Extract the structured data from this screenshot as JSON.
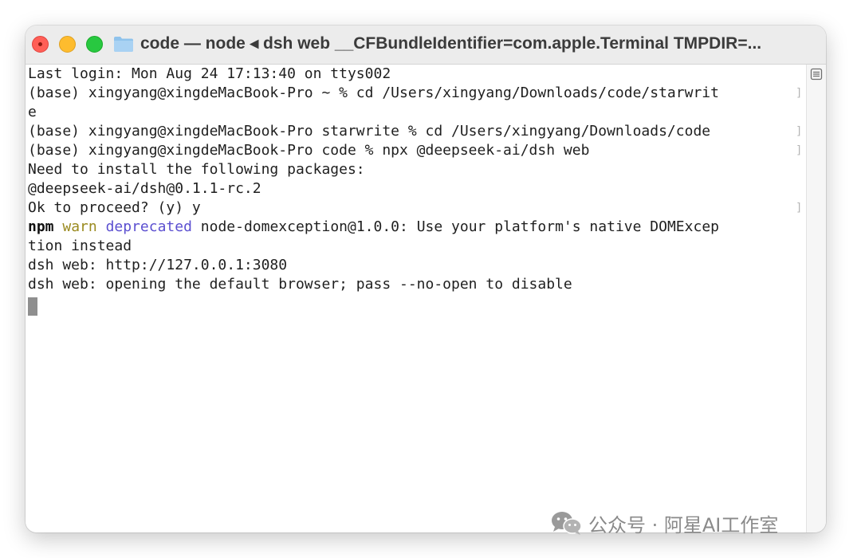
{
  "window": {
    "title": "code — node ◂ dsh web __CFBundleIdentifier=com.apple.Terminal TMPDIR=..."
  },
  "icons": {
    "close": "close-icon",
    "minimize": "minimize-icon",
    "maximize": "maximize-icon",
    "folder": "folder-icon",
    "scrollbar": "scrollbar-toggle-icon",
    "watermark": "wechat-icon"
  },
  "colors": {
    "close": "#ff5f57",
    "minimize": "#febc2e",
    "maximize": "#28c840",
    "warn": "#9a8a1f",
    "deprecated": "#5b4fd0"
  },
  "terminal": {
    "lines": [
      "Last login: Mon Aug 24 17:13:40 on ttys002",
      "(base) xingyang@xingdeMacBook-Pro ~ % cd /Users/xingyang/Downloads/code/starwrit",
      "e",
      "(base) xingyang@xingdeMacBook-Pro starwrite % cd /Users/xingyang/Downloads/code",
      "(base) xingyang@xingdeMacBook-Pro code % npx @deepseek-ai/dsh web",
      "Need to install the following packages:",
      "@deepseek-ai/dsh@0.1.1-rc.2",
      "Ok to proceed? (y) y",
      "",
      "tion instead",
      "dsh web: http://127.0.0.1:3080",
      "dsh web: opening the default browser; pass --no-open to disable"
    ],
    "npm_line": {
      "npm": "npm",
      "warn": "warn",
      "deprecated": "deprecated",
      "message": " node-domexception@1.0.0: Use your platform's native DOMExcep"
    },
    "bracket_mark": "]"
  },
  "watermark": {
    "text": "公众号 · 阿星AI工作室"
  }
}
